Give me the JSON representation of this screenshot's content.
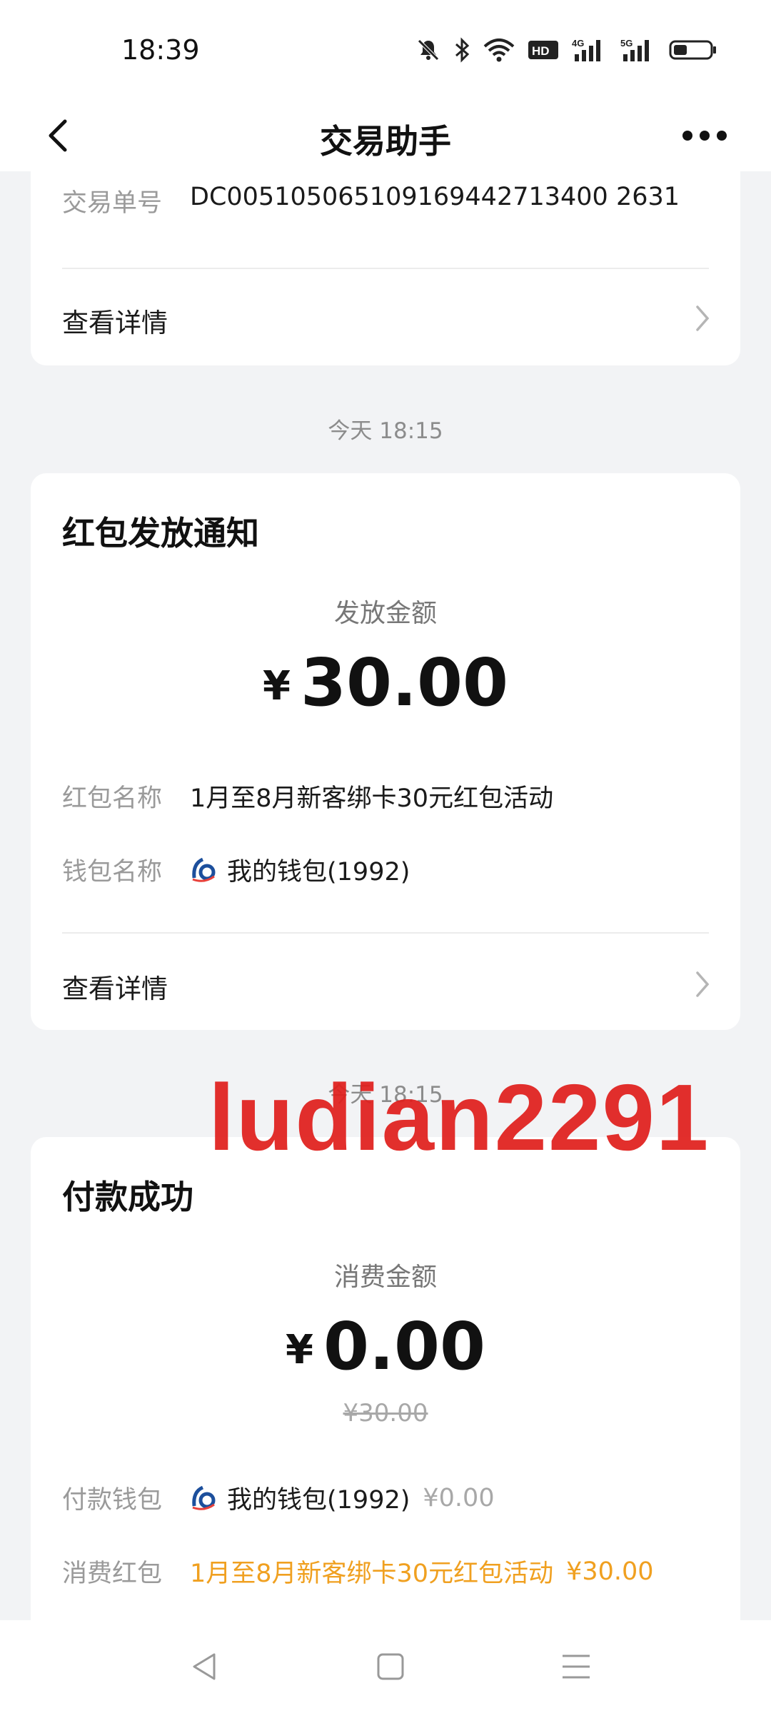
{
  "status_bar": {
    "time": "18:39",
    "icons": [
      "mute-icon",
      "bluetooth-icon",
      "wifi-icon",
      "hd-icon",
      "4g-signal-icon",
      "5g-signal-icon",
      "battery-icon"
    ]
  },
  "header": {
    "title": "交易助手",
    "back_icon": "chevron-left-icon",
    "more_icon": "more-icon"
  },
  "card_top": {
    "order_label": "交易单号",
    "order_value": "DC005105065109169442713400 2631",
    "detail_label": "查看详情"
  },
  "separator_1": "今天 18:15",
  "red_packet_card": {
    "title": "红包发放通知",
    "amount_caption": "发放金额",
    "currency": "¥",
    "amount": "30.00",
    "name_label": "红包名称",
    "name_value": "1月至8月新客绑卡30元红包活动",
    "wallet_label": "钱包名称",
    "wallet_value": "我的钱包(1992)",
    "detail_label": "查看详情"
  },
  "separator_2": "今天 18:15",
  "payment_card": {
    "title": "付款成功",
    "amount_caption": "消费金额",
    "currency": "¥",
    "amount": "0.00",
    "original_amount": "¥30.00",
    "pay_wallet_label": "付款钱包",
    "pay_wallet_value": "我的钱包(1992)",
    "pay_wallet_amount": "¥0.00",
    "packet_label": "消费红包",
    "packet_value": "1月至8月新客绑卡30元红包活动",
    "packet_amount": "¥30.00"
  },
  "watermark": "ludian2291",
  "colors": {
    "accent_orange": "#f0a020",
    "watermark_red": "#e0201d",
    "background": "#f2f3f5"
  }
}
